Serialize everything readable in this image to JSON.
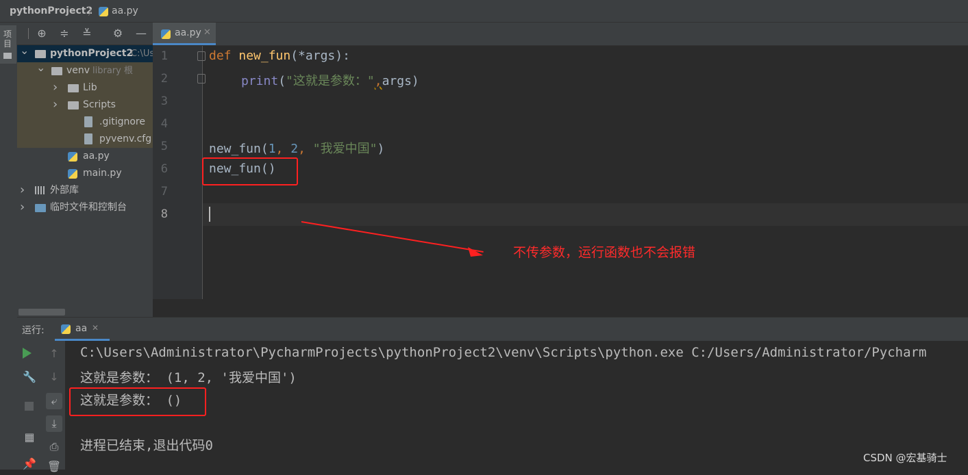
{
  "breadcrumb": {
    "project": "pythonProject2",
    "file": "aa.py"
  },
  "left_strip": {
    "project_tab": "项目"
  },
  "project_tree": [
    {
      "label": "pythonProject2",
      "hint": "C:\\Us",
      "indent": 0,
      "kind": "folder",
      "expanded": true
    },
    {
      "label": "venv",
      "hint": "library 根",
      "indent": 1,
      "kind": "folder",
      "expanded": true
    },
    {
      "label": "Lib",
      "hint": "",
      "indent": 2,
      "kind": "folder",
      "expanded": false
    },
    {
      "label": "Scripts",
      "hint": "",
      "indent": 2,
      "kind": "folder",
      "expanded": false
    },
    {
      "label": ".gitignore",
      "hint": "",
      "indent": 3,
      "kind": "file"
    },
    {
      "label": "pyvenv.cfg",
      "hint": "",
      "indent": 3,
      "kind": "file"
    },
    {
      "label": "aa.py",
      "hint": "",
      "indent": 2,
      "kind": "python"
    },
    {
      "label": "main.py",
      "hint": "",
      "indent": 2,
      "kind": "python"
    },
    {
      "label": "外部库",
      "hint": "",
      "indent": 0,
      "kind": "library",
      "expanded": false
    },
    {
      "label": "临时文件和控制台",
      "hint": "",
      "indent": 0,
      "kind": "scratch",
      "expanded": false
    }
  ],
  "editor": {
    "tab_label": "aa.py",
    "line_numbers": [
      "1",
      "2",
      "3",
      "4",
      "5",
      "6",
      "7",
      "8"
    ],
    "code": {
      "l1_def": "def ",
      "l1_name": "new_fun",
      "l1_rest": "(*args):",
      "l2_print": "print",
      "l2_paren": "(",
      "l2_str": "\"这就是参数：\"",
      "l2_comma": ",",
      "l2_rest": "args)",
      "l5_call": "new_fun(",
      "l5_n1": "1",
      "l5_sep1": ", ",
      "l5_n2": "2",
      "l5_sep2": ", ",
      "l5_str": "\"我爱中国\"",
      "l5_end": ")",
      "l6_call": "new_fun()"
    },
    "annotation": "不传参数，运行函数也不会报错"
  },
  "run_panel": {
    "title": "运行:",
    "tab_label": "aa",
    "console_lines": [
      "C:\\Users\\Administrator\\PycharmProjects\\pythonProject2\\venv\\Scripts\\python.exe C:/Users/Administrator/Pycharm",
      "这就是参数： (1, 2, '我爱中国')",
      "这就是参数： ()",
      "",
      "进程已结束,退出代码0"
    ]
  },
  "watermark": "CSDN @宏基骑士",
  "colors": {
    "annotation_red": "#ff2020",
    "accent_blue": "#4a88c7",
    "keyword": "#cc7832",
    "function": "#ffc66d",
    "string": "#6a8759",
    "number": "#6897bb"
  }
}
